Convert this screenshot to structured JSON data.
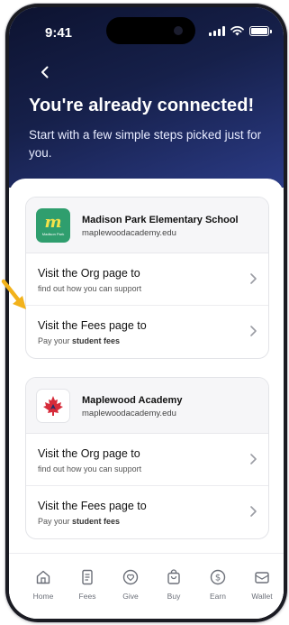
{
  "status_bar": {
    "time": "9:41"
  },
  "header": {
    "title": "You're already connected!",
    "subtitle": "Start with a few simple steps picked just for you."
  },
  "cards": [
    {
      "org_name": "Madison Park Elementary School",
      "domain": "maplewoodacademy.edu",
      "logo_mark": "m",
      "logo_text": "Madison Park",
      "rows": [
        {
          "title": "Visit the Org page to",
          "sub": "find out how you can support"
        },
        {
          "title": "Visit the Fees page to",
          "sub_prefix": "Pay your ",
          "sub_bold": "student fees"
        }
      ]
    },
    {
      "org_name": "Maplewood Academy",
      "domain": "maplewoodacademy.edu",
      "rows": [
        {
          "title": "Visit the Org page to",
          "sub": "find out how you can support"
        },
        {
          "title": "Visit the Fees page to",
          "sub_prefix": "Pay your ",
          "sub_bold": "student fees"
        }
      ]
    }
  ],
  "tabs": [
    {
      "label": "Home",
      "icon": "home-icon"
    },
    {
      "label": "Fees",
      "icon": "receipt-icon"
    },
    {
      "label": "Give",
      "icon": "heart-icon"
    },
    {
      "label": "Buy",
      "icon": "shopping-bag-icon"
    },
    {
      "label": "Earn",
      "icon": "dollar-coin-icon"
    },
    {
      "label": "Wallet",
      "icon": "wallet-icon"
    }
  ],
  "colors": {
    "hero_top": "#0d1330",
    "hero_bottom": "#2b3b86",
    "annotation_arrow": "#f2b21b",
    "school_logo_bg": "#2f9e6e",
    "maple_leaf": "#d62b3a"
  }
}
